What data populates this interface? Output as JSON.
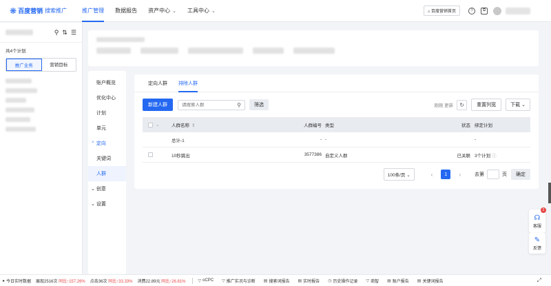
{
  "header": {
    "logo": "百度营销",
    "logo_sub": "搜索推广",
    "nav": [
      "推广管理",
      "数据报告",
      "资产中心",
      "工具中心"
    ],
    "home_button": "百度营销首页"
  },
  "sidebar": {
    "count_label": "共4个计划",
    "tabs": [
      "推广业务",
      "营销目标"
    ]
  },
  "subnav": {
    "items": [
      "账户概览",
      "优化中心",
      "计划",
      "单元"
    ],
    "group_targeting": "定向",
    "children": [
      "关键词",
      "人群"
    ],
    "group_creative": "创意",
    "group_settings": "设置"
  },
  "content": {
    "tabs": [
      "定向人群",
      "排除人群"
    ],
    "new_button": "新建人群",
    "search_placeholder": "请搜索人群",
    "filter_button": "筛选",
    "refresh_text": "刚刚 更新",
    "reset_columns": "重置列宽",
    "download": "下载",
    "table": {
      "headers": [
        "人群名称",
        "人群编号",
        "类型",
        "状态",
        "绑定计划"
      ],
      "summary_row": [
        "总计-1",
        "-",
        "-",
        "",
        "-"
      ],
      "rows": [
        [
          "10秒跳出",
          "3577386",
          "自定义人群",
          "已关联",
          "3个计划"
        ]
      ]
    },
    "pager": {
      "page_size": "100条/页",
      "current": "1",
      "goto_label": "去第",
      "page_suffix": "页",
      "confirm": "确定"
    }
  },
  "float": {
    "service": "客服",
    "feedback": "反馈",
    "badge": "2"
  },
  "bottombar": {
    "title": "今日实时数据",
    "stats": [
      {
        "label": "展现2516次",
        "change": "同比↑157.26%"
      },
      {
        "label": "点击36次",
        "change": "同比↑33.33%"
      },
      {
        "label": "消费22.89元",
        "change": "同比↑26.81%"
      }
    ],
    "links": [
      "oCPC",
      "推广实况与诊断",
      "搜索词报告",
      "实时报告",
      "历史操作记录",
      "商智",
      "账户报告",
      "关键词报告"
    ]
  }
}
